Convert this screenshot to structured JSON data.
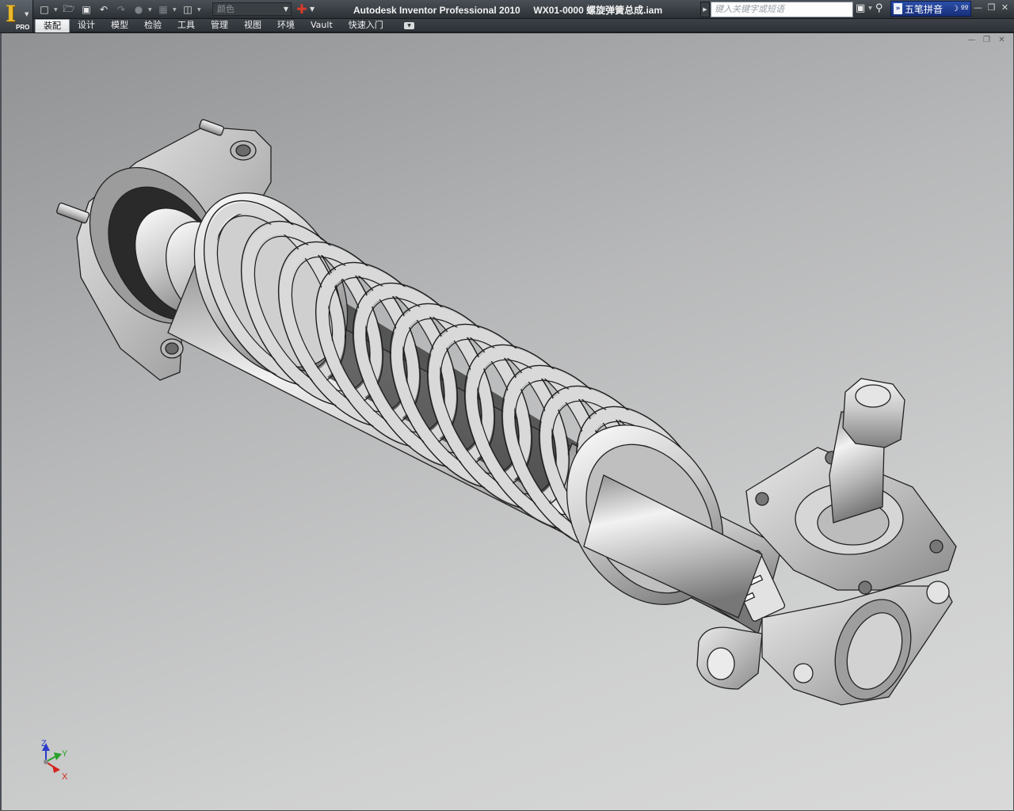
{
  "app": {
    "logo_letter": "I",
    "edition": "PRO",
    "title": "Autodesk Inventor Professional 2010     WX01-0000 螺旋弹簧总成.iam"
  },
  "quick_access": {
    "color_combo": "颜色"
  },
  "help": {
    "search_placeholder": "键入关键字或短语"
  },
  "ime": {
    "name": "五笔拼音"
  },
  "tabs": [
    {
      "label": "装配",
      "active": true
    },
    {
      "label": "设计"
    },
    {
      "label": "模型"
    },
    {
      "label": "检验"
    },
    {
      "label": "工具"
    },
    {
      "label": "管理"
    },
    {
      "label": "视图"
    },
    {
      "label": "环境"
    },
    {
      "label": "Vault"
    },
    {
      "label": "快速入门"
    }
  ],
  "triad": {
    "z": "Z",
    "y": "Y",
    "x": "X",
    "colors": {
      "z": "#2a3cc8",
      "y": "#27a22b",
      "x": "#d4241c"
    }
  },
  "colors": {
    "accent": "#e9b72a",
    "viewport_top": "#8f9193",
    "viewport_bottom": "#d9d9d9"
  }
}
